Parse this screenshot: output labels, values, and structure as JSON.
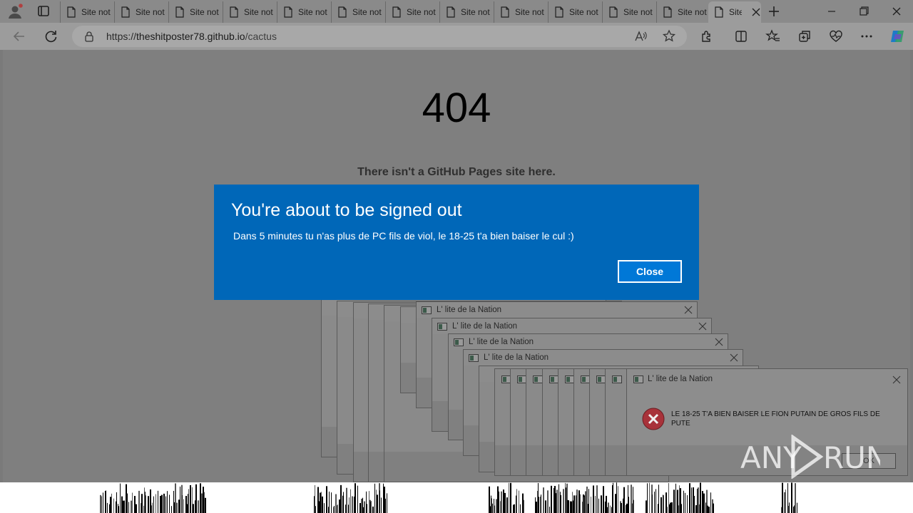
{
  "browser": {
    "tabs": [
      {
        "title": "Site not found · GitHub Pages"
      },
      {
        "title": "Site not found · GitHub Pages"
      },
      {
        "title": "Site not found · GitHub Pages"
      },
      {
        "title": "Site not found · GitHub Pages"
      },
      {
        "title": "Site not found · GitHub Pages"
      },
      {
        "title": "Site not found · GitHub Pages"
      },
      {
        "title": "Site not found · GitHub Pages"
      },
      {
        "title": "Site not found · GitHub Pages"
      },
      {
        "title": "Site not found · GitHub Pages"
      },
      {
        "title": "Site not found · GitHub Pages"
      },
      {
        "title": "Site not found · GitHub Pages"
      },
      {
        "title": "Site not found · GitHub Pages"
      },
      {
        "title": "Site not found · GitHub Pages",
        "active": true
      }
    ],
    "url": {
      "scheme": "https://",
      "host": "theshitposter78.github.io",
      "path": "/cactus"
    }
  },
  "page": {
    "code": "404",
    "subtitle": "There isn't a GitHub Pages site here."
  },
  "error_windows": {
    "title": "L' lite de la Nation",
    "message": "LE 18-25 T'A BIEN BAISER LE FION PUTAIN DE GROS FILS DE PUTE",
    "ok_label": "OK"
  },
  "signout_dialog": {
    "heading": "You're about to be signed out",
    "body": "Dans 5 minutes tu n'as plus de PC fils de viol, le 18-25 t'a bien baiser le cul :)",
    "close_label": "Close"
  },
  "watermark": {
    "text": "ANY RUN"
  },
  "colors": {
    "dialog_blue": "#0067b8",
    "page_gray": "#7f7f7f",
    "error_red": "#b02a30"
  }
}
